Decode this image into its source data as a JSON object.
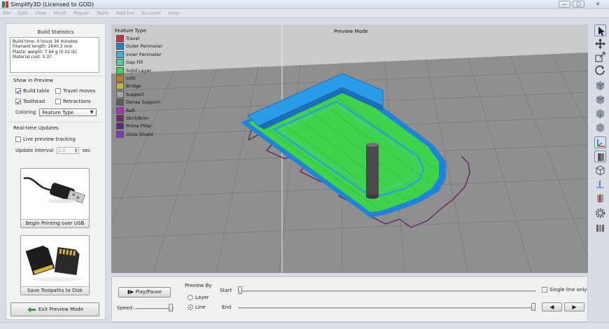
{
  "window": {
    "title": "Simplify3D (Licensed to GOD)",
    "minimize": "—",
    "maximize": "□",
    "close": "✕"
  },
  "menu": [
    "File",
    "Edit",
    "View",
    "Mesh",
    "Repair",
    "Tools",
    "Add-Ins",
    "Account",
    "Help"
  ],
  "build_statistics": {
    "title": "Build Statistics",
    "lines": [
      "Build time: 0 hours 36 minutes",
      "Filament length: 2640.3 mm",
      "Plastic weight: 7.94 g (0.02 lb)",
      "Material cost: 0.37"
    ]
  },
  "show_in_preview": {
    "title": "Show in Preview",
    "build_table": {
      "label": "Build table",
      "checked": true
    },
    "travel_moves": {
      "label": "Travel moves",
      "checked": false
    },
    "toolhead": {
      "label": "Toolhead",
      "checked": true
    },
    "retractions": {
      "label": "Retractions",
      "checked": false
    },
    "coloring_label": "Coloring",
    "coloring_value": "Feature Type"
  },
  "realtime_updates": {
    "title": "Real-time Updates",
    "live_label": "Live preview tracking",
    "interval_label": "Update interval",
    "interval_value": "5.0",
    "interval_unit": "sec"
  },
  "usb_button": {
    "label": "Begin Printing over USB"
  },
  "sd_button": {
    "label": "Save Toolpaths to Disk"
  },
  "exit_button": {
    "label": "Exit Preview Mode"
  },
  "viewport": {
    "mode_label": "Preview Mode",
    "legend_title": "Feature Type",
    "legend": [
      {
        "name": "Travel",
        "color": "#c8333a"
      },
      {
        "name": "Outer Perimeter",
        "color": "#1f84d8"
      },
      {
        "name": "Inner Perimeter",
        "color": "#38b4e8"
      },
      {
        "name": "Gap Fill",
        "color": "#48cfa0"
      },
      {
        "name": "Solid Layer",
        "color": "#3fd24d"
      },
      {
        "name": "Infill",
        "color": "#c47a1e"
      },
      {
        "name": "Bridge",
        "color": "#c2bc26"
      },
      {
        "name": "Support",
        "color": "#a3a3a3"
      },
      {
        "name": "Dense Support",
        "color": "#5c5c5c"
      },
      {
        "name": "Raft",
        "color": "#b72ac0"
      },
      {
        "name": "Skirt/Brim",
        "color": "#6c2a6c"
      },
      {
        "name": "Prime Pillar",
        "color": "#5b2a84"
      },
      {
        "name": "Ooze Shield",
        "color": "#8b2fc9"
      }
    ]
  },
  "right_toolbar": {
    "icons": [
      "select-arrow-icon",
      "move-icon",
      "scale-icon",
      "rotate-icon",
      "view-cube-icon",
      "view-cube-icon-2",
      "view-cube-icon-3",
      "view-cube-icon-4",
      "axes-icon",
      "solid-cube-icon",
      "wire-cube-icon",
      "axis-z-icon",
      "section-icon",
      "settings-gear-icon",
      "columns-icon"
    ]
  },
  "bottom": {
    "play_label": "Play/Pause",
    "speed_label": "Speed:",
    "preview_by_title": "Preview By",
    "layer_label": "Layer",
    "line_label": "Line",
    "preview_by_selected": "Line",
    "start_label": "Start",
    "end_label": "End",
    "single_line_label": "Single line only",
    "start_position": 0.0,
    "end_position": 1.0,
    "speed_position": 0.97
  }
}
